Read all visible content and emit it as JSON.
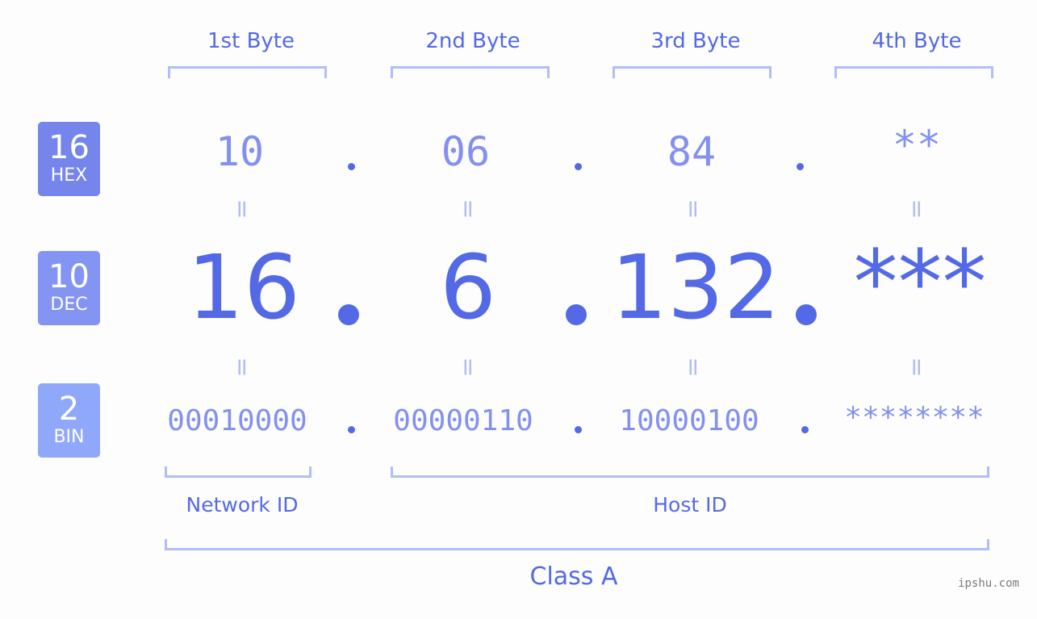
{
  "colors": {
    "accent": "#5469e5",
    "light_accent": "#8390ef",
    "bracket": "#b3bdf6",
    "hex_badge": "#7585eb",
    "dec_badge": "#8494f2",
    "bin_badge": "#8fa8f9",
    "background": "#fcfdfc"
  },
  "badges": [
    {
      "number": "16",
      "label": "HEX"
    },
    {
      "number": "10",
      "label": "DEC"
    },
    {
      "number": "2",
      "label": "BIN"
    }
  ],
  "byte_headers": [
    "1st Byte",
    "2nd Byte",
    "3rd Byte",
    "4th Byte"
  ],
  "hex": [
    "10",
    "06",
    "84",
    "**"
  ],
  "dec": [
    "16",
    "6",
    "132",
    "***"
  ],
  "bin": [
    "00010000",
    "00000110",
    "10000100",
    "********"
  ],
  "equals_sign": "=",
  "network_label": "Network ID",
  "host_label": "Host ID",
  "class_label": "Class A",
  "watermark": "ipshu.com"
}
